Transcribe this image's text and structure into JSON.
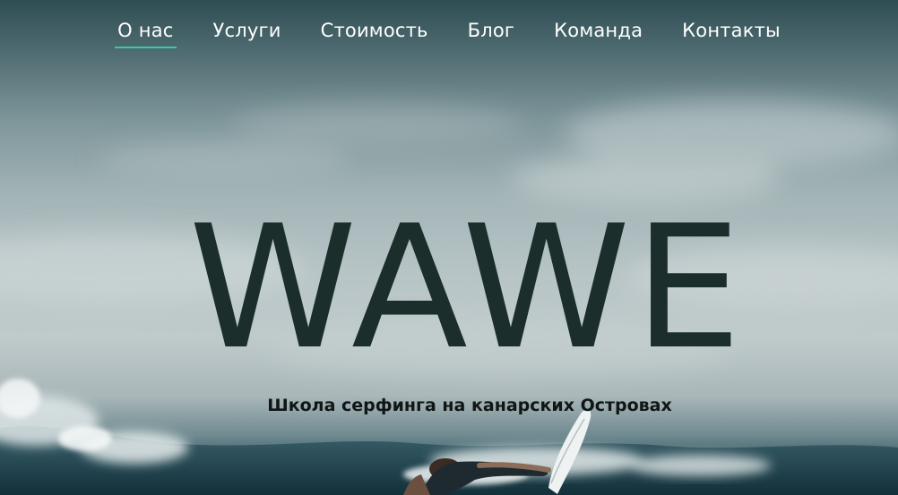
{
  "nav": {
    "items": [
      {
        "label": "О нас"
      },
      {
        "label": "Услуги"
      },
      {
        "label": "Стоимость"
      },
      {
        "label": "Блог"
      },
      {
        "label": "Команда"
      },
      {
        "label": "Контакты"
      }
    ],
    "active_index": 0,
    "accent_color": "#3ec6a4"
  },
  "hero": {
    "brand": "WAWE",
    "tagline": "Школа серфинга на канарских Островах",
    "brand_color": "#1b2e2c",
    "background": "surfer-on-wave-photo"
  }
}
